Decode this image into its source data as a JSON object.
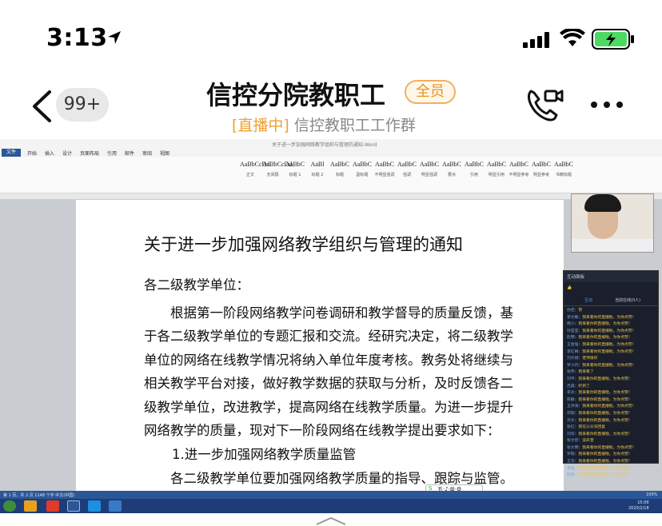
{
  "status_bar": {
    "time": "3:13",
    "icons": [
      "location-arrow-icon",
      "signal-icon",
      "wifi-icon",
      "battery-charging-icon"
    ],
    "battery_color": "#4cd964"
  },
  "chat_header": {
    "unread_count": "99+",
    "title": "信控分院教职工",
    "member_tag": "全员",
    "live_tag": "[直播中]",
    "subtitle": "信控教职工工作群",
    "accent_color": "#f0a030"
  },
  "word": {
    "window_title": "关于进一步加强网络教学组织与管理的通知-Word",
    "tabs": [
      "文件",
      "开始",
      "插入",
      "设计",
      "页面布局",
      "引用",
      "邮件",
      "审阅",
      "视图"
    ],
    "styles": [
      {
        "sample": "AaBbCcDd",
        "name": "正文"
      },
      {
        "sample": "AaBbCcDd",
        "name": "无间隔"
      },
      {
        "sample": "AaBbC",
        "name": "标题 1"
      },
      {
        "sample": "AaBl",
        "name": "标题 2"
      },
      {
        "sample": "AaBbC",
        "name": "标题"
      },
      {
        "sample": "AaBbC",
        "name": "副标题"
      },
      {
        "sample": "AaBbC",
        "name": "不明显强调"
      },
      {
        "sample": "AaBbC",
        "name": "强调"
      },
      {
        "sample": "AaBbC",
        "name": "明显强调"
      },
      {
        "sample": "AaBbC",
        "name": "要点"
      },
      {
        "sample": "AaBbC",
        "name": "引用"
      },
      {
        "sample": "AaBbC",
        "name": "明显引用"
      },
      {
        "sample": "AaBbC",
        "name": "不明显参考"
      },
      {
        "sample": "AaBbC",
        "name": "明显参考"
      },
      {
        "sample": "AaBbC",
        "name": "书籍标题"
      }
    ],
    "document": {
      "title": "关于进一步加强网络教学组织与管理的通知",
      "salutation": "各二级教学单位：",
      "lines": [
        "根据第一阶段网络教学问卷调研和教学督导的质量反馈，基",
        "于各二级教学单位的专题汇报和交流。经研究决定，将二级教学",
        "单位的网络在线教学情况将纳入单位年度考核。教务处将继续与",
        "相关教学平台对接，做好教学数据的获取与分析，及时反馈各二",
        "级教学单位，改进教学，提高网络在线教学质量。为进一步提升",
        "网络教学的质量，现对下一阶段网络在线教学提出要求如下："
      ],
      "item1": "1.进一步加强网络教学质量监管",
      "item1_text": "各二级教学单位要加强网络教学质量的指导、跟踪与监管。"
    },
    "status_text": "第 1 页，共 2 页    1148 个字    中文(中国)",
    "zoom": "100%"
  },
  "interaction_panel": {
    "title": "互动面板",
    "tabs": [
      "互动",
      "当前在线(0人)"
    ],
    "messages": [
      {
        "user": "仿佳",
        "text": "赞"
      },
      {
        "user": "李文静",
        "text": "我来看你的直播啦，为你点赞！"
      },
      {
        "user": "杨小",
        "text": "我来看你的直播啦，为你点赞！"
      },
      {
        "user": "孙莹莹",
        "text": "我来看你的直播啦，为你点赞！"
      },
      {
        "user": "赵明",
        "text": "我来看你的直播啦，为你点赞！"
      },
      {
        "user": "王金强",
        "text": "我来看你的直播啦，为你点赞！"
      },
      {
        "user": "李红梅",
        "text": "我来看你的直播啦，为你点赞！"
      },
      {
        "user": "刘文斌",
        "text": "老师很好"
      },
      {
        "user": "罗小丹",
        "text": "我来看你的直播啦，为你点赞！"
      },
      {
        "user": "张伟",
        "text": "我来看了"
      },
      {
        "user": "刘平",
        "text": "我来看你的直播啦，为你点赞！"
      },
      {
        "user": "吕晨",
        "text": "听到了"
      },
      {
        "user": "李冰",
        "text": "我来看你的直播啦，为你点赞！"
      },
      {
        "user": "陈静",
        "text": "我来看你的直播啦，为你点赞！"
      },
      {
        "user": "王洪涛",
        "text": "我来看你的直播啦，为你点赞！"
      },
      {
        "user": "邓刚",
        "text": "我来看你的直播啦，为你点赞！"
      },
      {
        "user": "许文",
        "text": "我来看你的直播啦，为你点赞！"
      },
      {
        "user": "张红",
        "text": "我在公众号回复"
      },
      {
        "user": "刘华",
        "text": "我来看你的直播啦，为你点赞！"
      },
      {
        "user": "张文宏",
        "text": "没声音"
      },
      {
        "user": "张文明",
        "text": "我来看你的直播啦，为你点赞！"
      },
      {
        "user": "罗刚",
        "text": "我来看你的直播啦，为你点赞！"
      },
      {
        "user": "王华",
        "text": "我来看你的直播啦，为你点赞！"
      },
      {
        "user": "李强",
        "text": "我来看你的直播啦，为你点赞！"
      },
      {
        "user": "赵刚",
        "text": "我来看你的直播啦，为你点赞！"
      }
    ]
  },
  "taskbar": {
    "clock": "15:06",
    "date": "2020/2/18"
  }
}
